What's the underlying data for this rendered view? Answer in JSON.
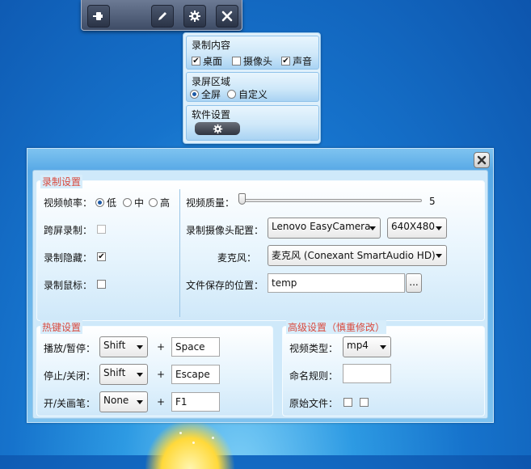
{
  "toolbar": {
    "icons": [
      "pin-icon",
      "pencil-icon",
      "gear-icon",
      "close-icon"
    ]
  },
  "menu": {
    "record_content": {
      "title": "录制内容",
      "options": [
        {
          "label": "桌面",
          "checked": true
        },
        {
          "label": "摄像头",
          "checked": false
        },
        {
          "label": "声音",
          "checked": true
        }
      ]
    },
    "record_area": {
      "title": "录屏区域",
      "options": [
        {
          "label": "全屏",
          "selected": true
        },
        {
          "label": "自定义",
          "selected": false
        }
      ]
    },
    "software_settings": {
      "title": "软件设置",
      "icon": "gear-icon"
    }
  },
  "settings": {
    "recording": {
      "title": "录制设置",
      "frame_rate": {
        "label": "视频帧率：",
        "options": [
          "低",
          "中",
          "高"
        ],
        "selected": "低"
      },
      "cross_screen": {
        "label": "跨屏录制：",
        "checked": false
      },
      "hidden": {
        "label": "录制隐藏：",
        "checked": true
      },
      "mouse": {
        "label": "录制鼠标：",
        "checked": false
      },
      "quality": {
        "label": "视频质量：",
        "value": "5",
        "level": 0
      },
      "camera": {
        "label": "录制摄像头配置：",
        "device": "Lenovo EasyCamera",
        "resolution": "640X480"
      },
      "mic": {
        "label": "麦克风：",
        "device": "麦克风 (Conexant SmartAudio HD)"
      },
      "save_path": {
        "label": "文件保存的位置：",
        "value": "temp",
        "browse_label": "..."
      }
    },
    "hotkeys": {
      "title": "热键设置",
      "rows": [
        {
          "label": "播放/暂停：",
          "modifier": "Shift",
          "plus": "+",
          "key": "Space"
        },
        {
          "label": "停止/关闭：",
          "modifier": "Shift",
          "plus": "+",
          "key": "Escape"
        },
        {
          "label": "开/关画笔：",
          "modifier": "None",
          "plus": "+",
          "key": "F1"
        }
      ]
    },
    "advanced": {
      "title": "高级设置（慎重修改）",
      "video_type": {
        "label": "视频类型：",
        "value": "mp4"
      },
      "naming_rule": {
        "label": "命名规则：",
        "value": ""
      },
      "original_file": {
        "label": "原始文件：",
        "checks": [
          false,
          false
        ]
      }
    }
  },
  "colors": {
    "group_title": "#d94a3e",
    "window_bg": "#7ec3f0",
    "desktop": "#1673cc"
  }
}
